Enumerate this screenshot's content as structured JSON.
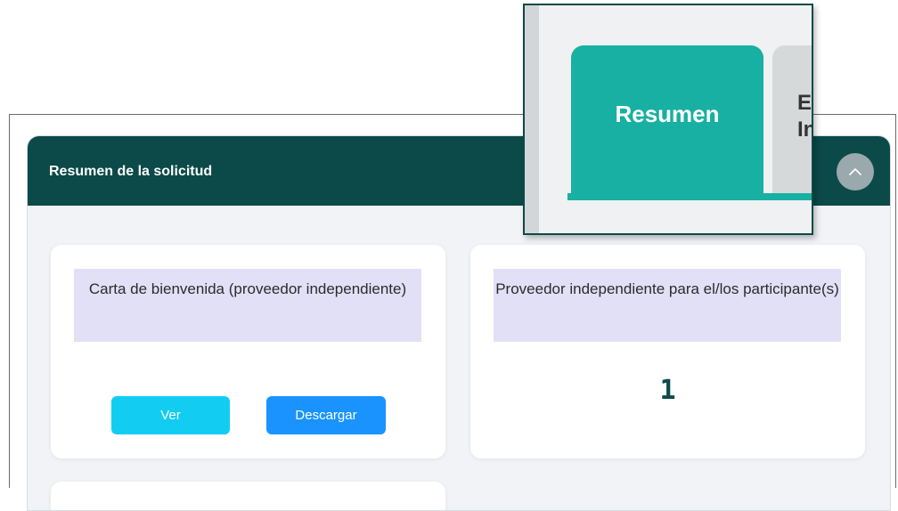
{
  "panel": {
    "title": "Resumen de la solicitud",
    "collapse_icon": "chevron-up-icon"
  },
  "cards": {
    "welcome_letter": {
      "label": "Carta de bienvenida (proveedor independiente)",
      "view_button": "Ver",
      "download_button": "Descargar"
    },
    "independent_provider": {
      "label": "Proveedor independiente para el/los participante(s)",
      "count": "1"
    }
  },
  "zoom_tabs": {
    "active_tab": "Resumen",
    "next_tab_partial": "E\nIn"
  },
  "colors": {
    "header_bg": "#0b4a48",
    "label_bg": "#e2e0f7",
    "ver_button": "#12cdf1",
    "descargar_button": "#1a93ff",
    "active_tab": "#18b0a3"
  }
}
